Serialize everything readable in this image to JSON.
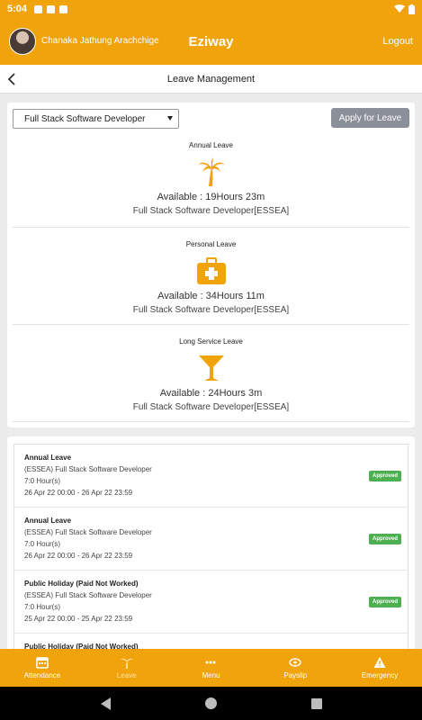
{
  "status_bar": {
    "time": "5:04"
  },
  "header": {
    "user_name": "Chanaka Jathung Arachchige",
    "app_title": "Eziway",
    "logout_label": "Logout"
  },
  "sub_header": {
    "title": "Leave Management"
  },
  "filter": {
    "selected_position": "Full Stack Software Developer",
    "apply_label": "Apply for Leave"
  },
  "balances": [
    {
      "title": "Annual Leave",
      "available": "Available : 19Hours 23m",
      "position": "Full Stack Software Developer[ESSEA]",
      "icon": "palm-tree-icon"
    },
    {
      "title": "Personal Leave",
      "available": "Available : 34Hours 11m",
      "position": "Full Stack Software Developer[ESSEA]",
      "icon": "first-aid-kit-icon"
    },
    {
      "title": "Long Service Leave",
      "available": "Available : 24Hours 3m",
      "position": "Full Stack Software Developer[ESSEA]",
      "icon": "cocktail-glass-icon"
    }
  ],
  "leave_requests": [
    {
      "type": "Annual Leave",
      "position": "(ESSEA) Full Stack Software Developer",
      "hours": "7:0 Hour(s)",
      "period": "26 Apr 22 00:00 - 26 Apr 22 23:59",
      "status": "Approved"
    },
    {
      "type": "Annual Leave",
      "position": "(ESSEA) Full Stack Software Developer",
      "hours": "7:0 Hour(s)",
      "period": "26 Apr 22 00:00 - 26 Apr 22 23:59",
      "status": "Approved"
    },
    {
      "type": "Public Holiday (Paid Not Worked)",
      "position": "(ESSEA) Full Stack Software Developer",
      "hours": "7:0 Hour(s)",
      "period": "25 Apr 22 00:00 - 25 Apr 22 23:59",
      "status": "Approved"
    },
    {
      "type": "Public Holiday (Paid Not Worked)",
      "position": "",
      "hours": "",
      "period": "",
      "status": ""
    }
  ],
  "bottom_nav": [
    {
      "label": "Attendance",
      "icon": "calendar-icon"
    },
    {
      "label": "Leave",
      "icon": "palm-tree-icon"
    },
    {
      "label": "Menu",
      "icon": "dots-icon"
    },
    {
      "label": "Payslip",
      "icon": "money-icon"
    },
    {
      "label": "Emergency",
      "icon": "warning-icon"
    }
  ],
  "colors": {
    "brand": "#f0a30a",
    "approved": "#4caf50",
    "apply_button": "#8b8f99"
  }
}
